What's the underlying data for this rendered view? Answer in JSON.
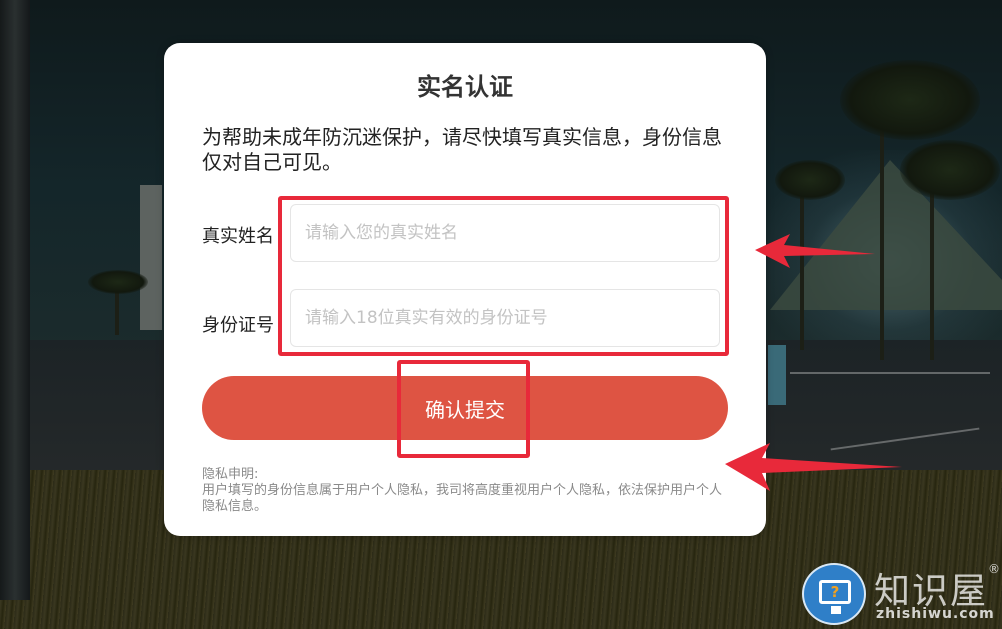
{
  "dialog": {
    "title": "实名认证",
    "intro": "为帮助未成年防沉迷保护，请尽快填写真实信息，身份信息仅对自己可见。",
    "fields": [
      {
        "label": "真实姓名",
        "placeholder": "请输入您的真实姓名",
        "value": ""
      },
      {
        "label": "身份证号",
        "placeholder": "请输入18位真实有效的身份证号",
        "value": ""
      }
    ],
    "submit_label": "确认提交",
    "privacy_heading": "隐私申明:",
    "privacy_body": "用户填写的身份信息属于用户个人隐私，我司将高度重视用户个人隐私，依法保护用户个人隐私信息。"
  },
  "annotations": {
    "color": "#e8293a"
  },
  "watermark": {
    "brand_cn": "知识屋",
    "brand_en": "zhishiwu.com",
    "registered_mark": "®",
    "icon": "monitor-question-icon",
    "icon_glyph": "?"
  },
  "colors": {
    "submit": "#de5443",
    "dialog_bg": "#ffffff"
  }
}
